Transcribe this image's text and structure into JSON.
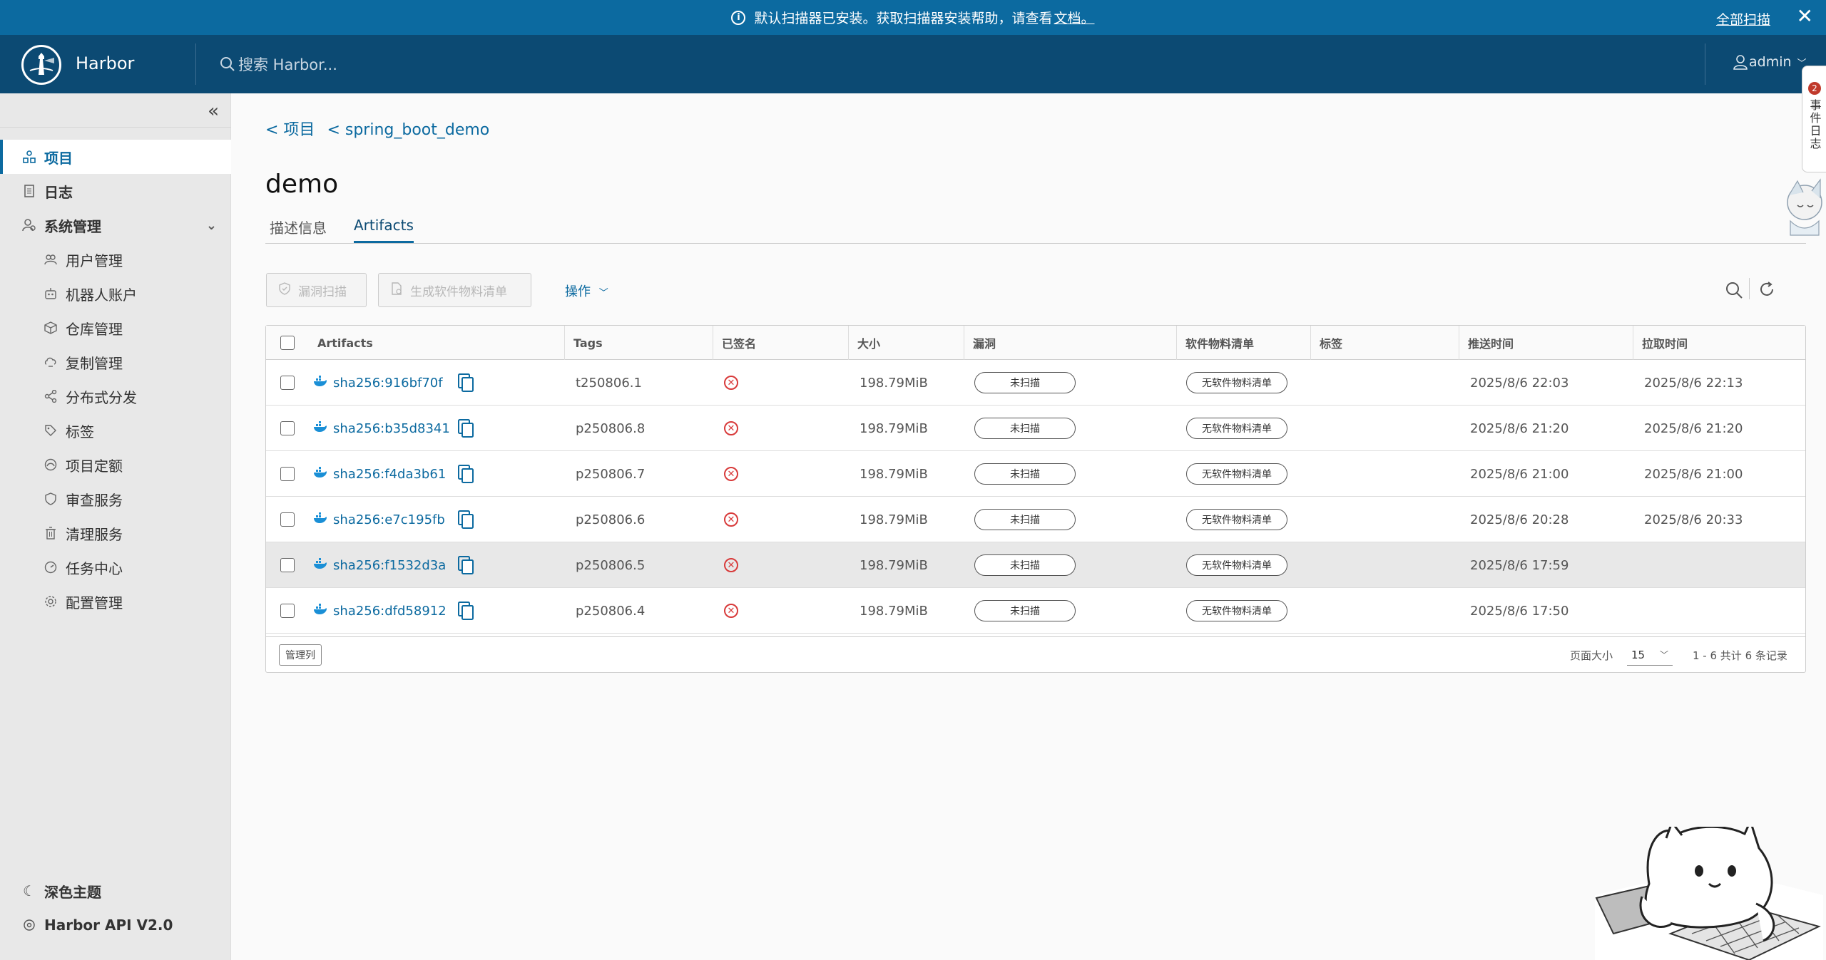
{
  "banner": {
    "message": "默认扫描器已安装。获取扫描器安装帮助，请查看",
    "link": "文档。",
    "scan_all": "全部扫描",
    "close": "✕"
  },
  "header": {
    "brand": "Harbor",
    "search_placeholder": "搜索 Harbor...",
    "user": "admin"
  },
  "sidebar": {
    "items": [
      {
        "label": "项目",
        "icon": "projects-icon",
        "active": true
      },
      {
        "label": "日志",
        "icon": "logs-icon"
      },
      {
        "label": "系统管理",
        "icon": "admin-icon"
      }
    ],
    "sub_items": [
      {
        "label": "用户管理",
        "icon": "users-icon"
      },
      {
        "label": "机器人账户",
        "icon": "robot-icon"
      },
      {
        "label": "仓库管理",
        "icon": "registry-icon"
      },
      {
        "label": "复制管理",
        "icon": "replication-icon"
      },
      {
        "label": "分布式分发",
        "icon": "distribution-icon"
      },
      {
        "label": "标签",
        "icon": "tag-icon"
      },
      {
        "label": "项目定额",
        "icon": "quota-icon"
      },
      {
        "label": "审查服务",
        "icon": "shield-icon"
      },
      {
        "label": "清理服务",
        "icon": "trash-icon"
      },
      {
        "label": "任务中心",
        "icon": "dashboard-icon"
      },
      {
        "label": "配置管理",
        "icon": "gear-icon"
      }
    ],
    "bottom": {
      "dark_theme": "深色主题",
      "api": "Harbor API V2.0"
    }
  },
  "breadcrumb": {
    "project": "< 项目",
    "repo": "< spring_boot_demo"
  },
  "page_title": "demo",
  "tabs": {
    "info": "描述信息",
    "artifacts": "Artifacts"
  },
  "toolbar": {
    "scan": "漏洞扫描",
    "sbom": "生成软件物料清单",
    "actions": "操作"
  },
  "table": {
    "columns": {
      "artifacts": "Artifacts",
      "tags": "Tags",
      "signed": "已签名",
      "size": "大小",
      "vuln": "漏洞",
      "sbom": "软件物料清单",
      "labels": "标签",
      "push_time": "推送时间",
      "pull_time": "拉取时间"
    },
    "rows": [
      {
        "digest": "sha256:916bf70f",
        "tag": "t250806.1",
        "size": "198.79MiB",
        "vuln": "未扫描",
        "sbom": "无软件物料清单",
        "push": "2025/8/6 22:03",
        "pull": "2025/8/6 22:13"
      },
      {
        "digest": "sha256:b35d8341",
        "tag": "p250806.8",
        "size": "198.79MiB",
        "vuln": "未扫描",
        "sbom": "无软件物料清单",
        "push": "2025/8/6 21:20",
        "pull": "2025/8/6 21:20"
      },
      {
        "digest": "sha256:f4da3b61",
        "tag": "p250806.7",
        "size": "198.79MiB",
        "vuln": "未扫描",
        "sbom": "无软件物料清单",
        "push": "2025/8/6 21:00",
        "pull": "2025/8/6 21:00"
      },
      {
        "digest": "sha256:e7c195fb",
        "tag": "p250806.6",
        "size": "198.79MiB",
        "vuln": "未扫描",
        "sbom": "无软件物料清单",
        "push": "2025/8/6 20:28",
        "pull": "2025/8/6 20:33"
      },
      {
        "digest": "sha256:f1532d3a",
        "tag": "p250806.5",
        "size": "198.79MiB",
        "vuln": "未扫描",
        "sbom": "无软件物料清单",
        "push": "2025/8/6 17:59",
        "pull": ""
      },
      {
        "digest": "sha256:dfd58912",
        "tag": "p250806.4",
        "size": "198.79MiB",
        "vuln": "未扫描",
        "sbom": "无软件物料清单",
        "push": "2025/8/6 17:50",
        "pull": ""
      }
    ],
    "footer": {
      "manage_columns": "管理列",
      "page_size_label": "页面大小",
      "page_size": "15",
      "count": "1 - 6 共计 6 条记录"
    }
  },
  "side_widget": {
    "badge": "2",
    "label": "事件日志"
  },
  "colors": {
    "banner": "#0c6aa0",
    "header": "#0c4a73",
    "link": "#0c6aa0",
    "error": "#d83a3a"
  }
}
